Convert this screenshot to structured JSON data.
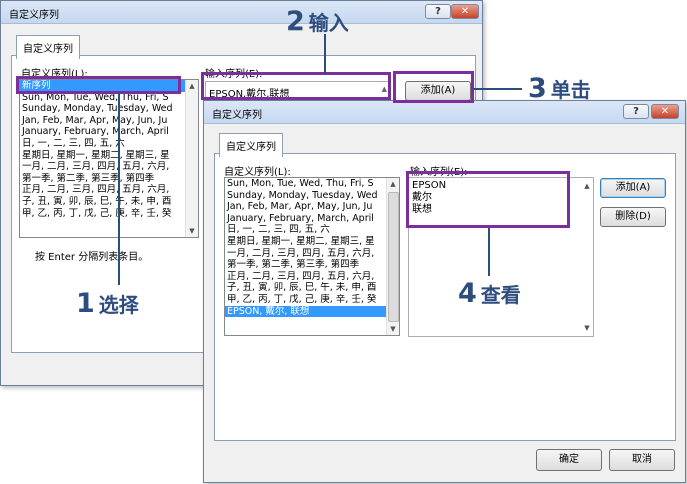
{
  "dialog1": {
    "title": "自定义序列",
    "tab": "自定义序列",
    "list_label": "自定义序列(L):",
    "list_items": [
      "新序列",
      "Sun, Mon, Tue, Wed, Thu, Fri, S",
      "Sunday, Monday, Tuesday, Wed",
      "Jan, Feb, Mar, Apr, May, Jun, Ju",
      "January, February, March, April",
      "日, 一, 二, 三, 四, 五, 六",
      "星期日, 星期一, 星期二, 星期三, 星",
      "一月, 二月, 三月, 四月, 五月, 六月,",
      "第一季, 第二季, 第三季, 第四季",
      "正月, 二月, 三月, 四月, 五月, 六月,",
      "子, 丑, 寅, 卯, 辰, 巳, 午, 未, 申, 酉",
      "甲, 乙, 丙, 丁, 戊, 己, 庚, 辛, 壬, 癸"
    ],
    "selected_index": 0,
    "input_label": "输入序列(E):",
    "input_value": "EPSON,戴尔,联想",
    "add_button": "添加(A)",
    "hint": "按 Enter 分隔列表条目。",
    "help_glyph": "?",
    "close_glyph": "✕"
  },
  "dialog2": {
    "title": "自定义序列",
    "tab": "自定义序列",
    "list_label": "自定义序列(L):",
    "list_items": [
      "Sun, Mon, Tue, Wed, Thu, Fri, S",
      "Sunday, Monday, Tuesday, Wed",
      "Jan, Feb, Mar, Apr, May, Jun, Ju",
      "January, February, March, April",
      "日, 一, 二, 三, 四, 五, 六",
      "星期日, 星期一, 星期二, 星期三, 星",
      "一月, 二月, 三月, 四月, 五月, 六月,",
      "第一季, 第二季, 第三季, 第四季",
      "正月, 二月, 三月, 四月, 五月, 六月,",
      "子, 丑, 寅, 卯, 辰, 巳, 午, 未, 申, 酉",
      "甲, 乙, 丙, 丁, 戊, 己, 庚, 辛, 壬, 癸",
      "EPSON, 戴尔, 联想"
    ],
    "selected_index": 11,
    "input_label": "输入序列(E):",
    "input_lines": [
      "EPSON",
      "戴尔",
      "联想"
    ],
    "add_button": "添加(A)",
    "delete_button": "删除(D)",
    "ok_button": "确定",
    "cancel_button": "取消",
    "help_glyph": "?",
    "close_glyph": "✕"
  },
  "callouts": {
    "step1": {
      "num": "1",
      "text": "选择"
    },
    "step2": {
      "num": "2",
      "text": "输入"
    },
    "step3": {
      "num": "3",
      "text": "单击"
    },
    "step4": {
      "num": "4",
      "text": "查看"
    }
  },
  "colors": {
    "highlight": "#7b2e9e",
    "callout": "#2e4d7f",
    "selection": "#3399ff"
  }
}
